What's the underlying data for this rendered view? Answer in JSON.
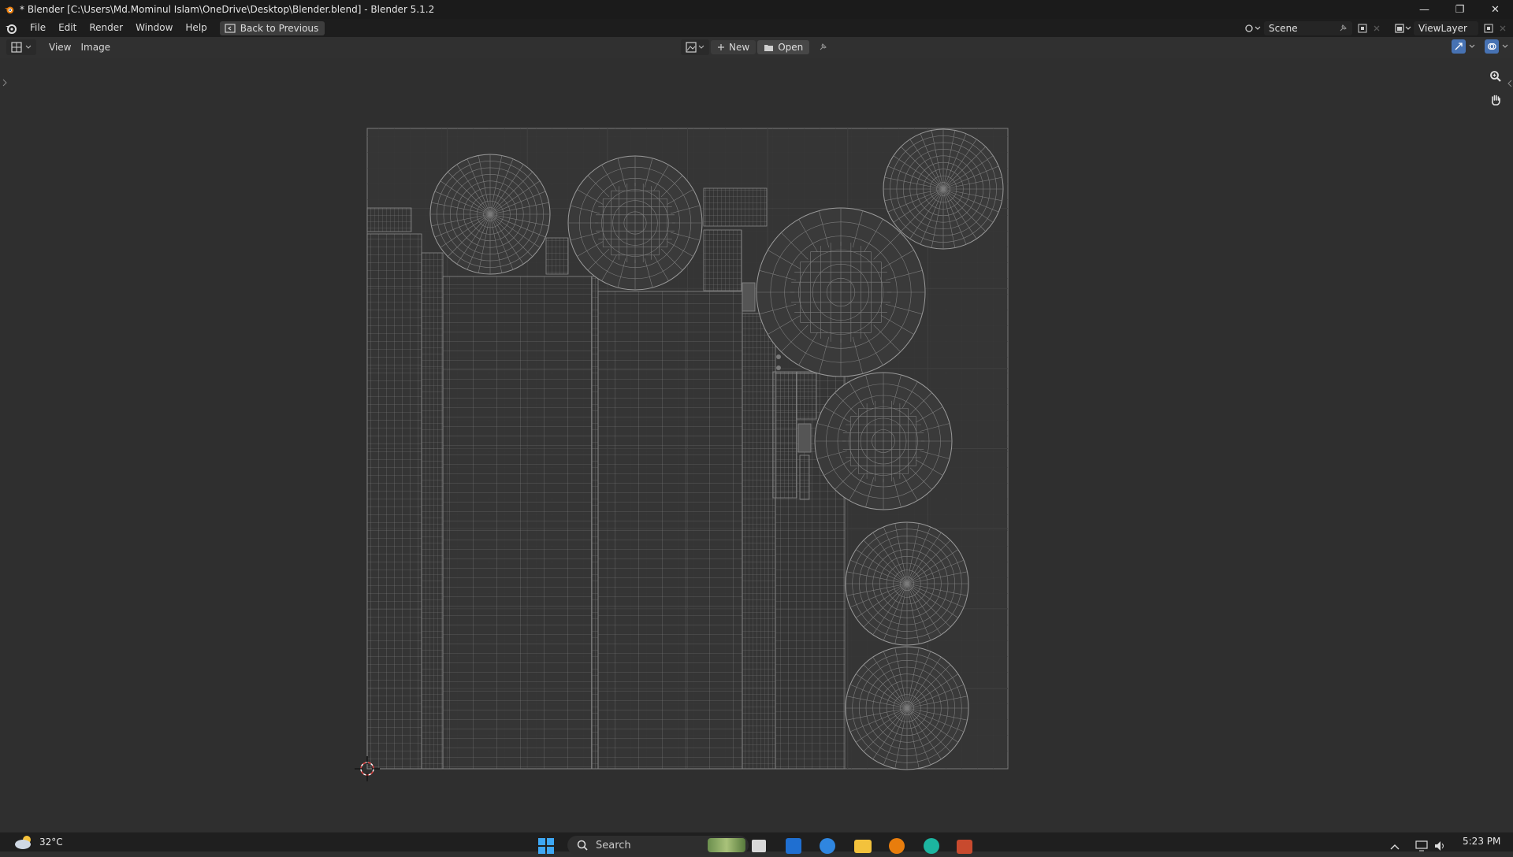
{
  "window": {
    "title": "* Blender [C:\\Users\\Md.Mominul Islam\\OneDrive\\Desktop\\Blender.blend] - Blender 5.1.2",
    "controls": {
      "minimize": "—",
      "maximize": "❐",
      "close": "✕"
    }
  },
  "menubar": {
    "items": [
      "File",
      "Edit",
      "Render",
      "Window",
      "Help"
    ],
    "back_button": "Back to Previous",
    "scene_label": "Scene",
    "viewlayer_label": "ViewLayer"
  },
  "editor_header": {
    "menus": [
      "View",
      "Image"
    ],
    "new_label": "New",
    "open_label": "Open"
  },
  "taskbar": {
    "temperature": "32°C",
    "search_placeholder": "Search",
    "time": "5:23 PM"
  },
  "colors": {
    "background": "#2f2f2f",
    "grid_lines": "#3d3d3d",
    "uv_wire": "#8a8a8a",
    "accent_blue": "#4772b3",
    "cursor_red": "#e04040"
  }
}
